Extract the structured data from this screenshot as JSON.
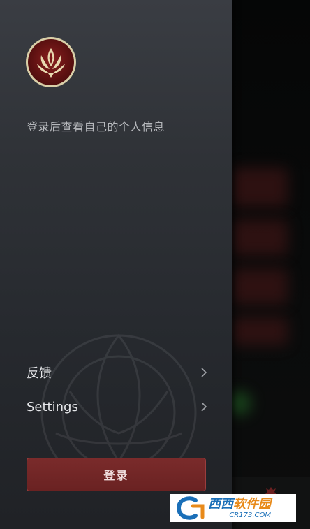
{
  "drawer": {
    "login_hint": "登录后查看自己的个人信息",
    "menu": [
      {
        "label": "反馈",
        "icon": "chevron-right-icon"
      },
      {
        "label": "Settings",
        "icon": "chevron-right-icon"
      }
    ],
    "login_button": "登录"
  },
  "watermark": {
    "brand_main": "西西",
    "brand_accent": "软件园",
    "brand_sub": "CR173.COM"
  },
  "colors": {
    "accent_red": "#7a2b2b",
    "drawer_bg": "#2f3237",
    "badge_blue": "#1a6fb8",
    "badge_orange": "#e88a1a"
  }
}
